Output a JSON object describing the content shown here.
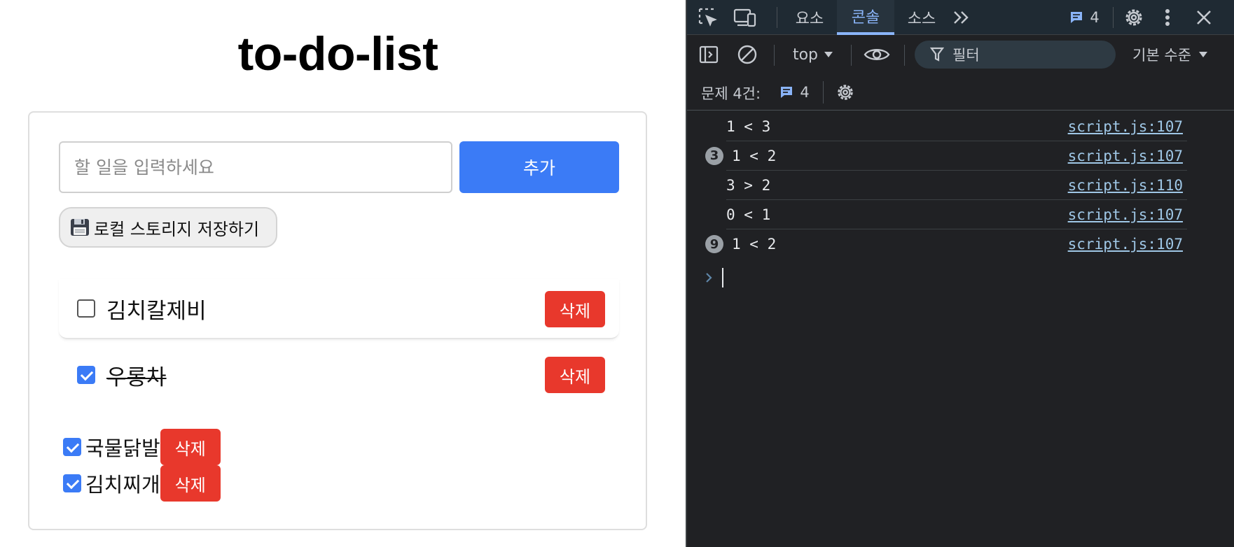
{
  "page": {
    "title": "to-do-list",
    "input": {
      "placeholder": "할 일을 입력하세요",
      "value": ""
    },
    "add_label": "추가",
    "save_label": "로컬 스토리지 저장하기",
    "save_icon": "floppy-disk-icon",
    "items": [
      {
        "text": "김치칼제비",
        "checked": false,
        "delete_label": "삭제",
        "style": "card"
      },
      {
        "text": "우롱차",
        "checked": true,
        "delete_label": "삭제",
        "style": "card"
      },
      {
        "text": "국물닭발",
        "checked": true,
        "delete_label": "삭제",
        "style": "plain"
      },
      {
        "text": "김치찌개",
        "checked": true,
        "delete_label": "삭제",
        "style": "plain"
      }
    ],
    "colors": {
      "primary": "#3b7bf6",
      "danger": "#e8382c"
    }
  },
  "devtools": {
    "tabs": [
      {
        "label": "요소",
        "active": false
      },
      {
        "label": "콘솔",
        "active": true
      },
      {
        "label": "소스",
        "active": false
      }
    ],
    "issues_badge": "4",
    "context": "top",
    "filter_placeholder": "필터",
    "level": "기본 수준",
    "issues_label": "문제 4건:",
    "issues_count": "4",
    "logs": [
      {
        "message": "1 < 3",
        "source": "script.js:107",
        "count": ""
      },
      {
        "message": "1 < 2",
        "source": "script.js:107",
        "count": "3"
      },
      {
        "message": "3 > 2",
        "source": "script.js:110",
        "count": ""
      },
      {
        "message": "0 < 1",
        "source": "script.js:107",
        "count": ""
      },
      {
        "message": "1 < 2",
        "source": "script.js:107",
        "count": "9"
      }
    ],
    "colors": {
      "background": "#202124",
      "accent": "#8ab4f8"
    }
  }
}
